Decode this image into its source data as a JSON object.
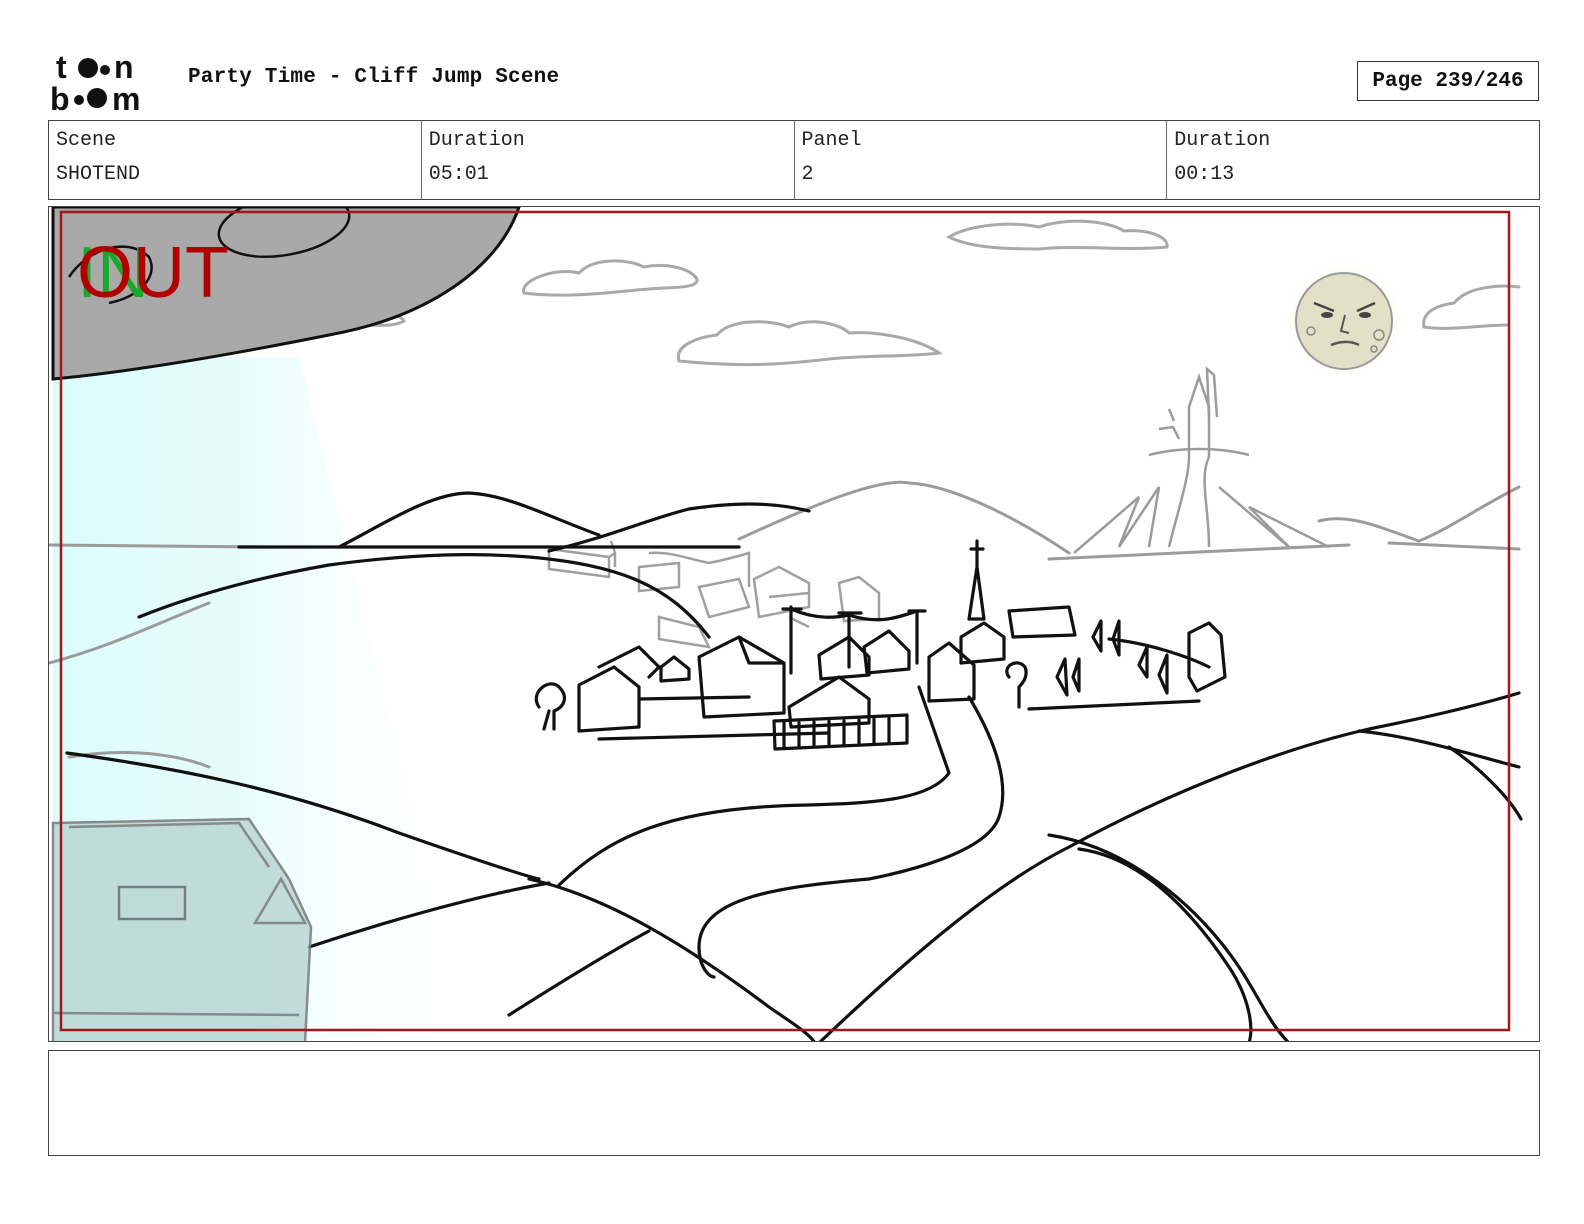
{
  "header": {
    "title": "Party Time - Cliff Jump Scene",
    "page": "Page 239/246"
  },
  "info": [
    {
      "label": "Scene",
      "value": "SHOTEND"
    },
    {
      "label": "Duration",
      "value": "05:01"
    },
    {
      "label": "Panel",
      "value": "2"
    },
    {
      "label": "Duration",
      "value": "00:13"
    }
  ],
  "panel": {
    "in_label": "IN",
    "out_label": "OUT"
  },
  "colors": {
    "in_marker": "#1aa82a",
    "out_marker": "#b10000",
    "frame_border": "#a01818"
  },
  "notes": ""
}
